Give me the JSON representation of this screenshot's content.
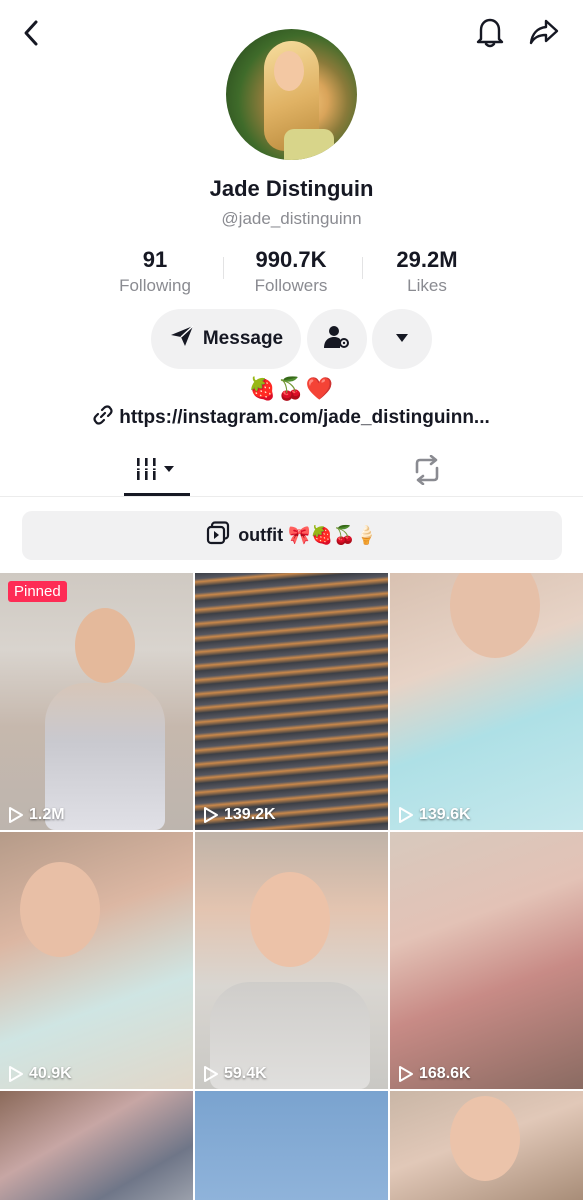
{
  "profile": {
    "name": "Jade Distinguin",
    "handle": "@jade_distinguinn",
    "stats": [
      {
        "value": "91",
        "label": "Following"
      },
      {
        "value": "990.7K",
        "label": "Followers"
      },
      {
        "value": "29.2M",
        "label": "Likes"
      }
    ],
    "message_label": "Message",
    "bio_emojis": "🍓🍒❤️",
    "link": "https://instagram.com/jade_distinguinn..."
  },
  "playlist": {
    "title": "outfit 🎀🍓🍒🍦"
  },
  "videos": [
    {
      "views": "1.2M",
      "pinned": "Pinned"
    },
    {
      "views": "139.2K"
    },
    {
      "views": "139.6K"
    },
    {
      "views": "40.9K"
    },
    {
      "views": "59.4K"
    },
    {
      "views": "168.6K"
    },
    {
      "views": ""
    },
    {
      "views": ""
    },
    {
      "views": ""
    }
  ],
  "icons": {
    "back": "back-arrow-icon",
    "bell": "bell-icon",
    "share": "share-icon",
    "send": "send-icon",
    "add_friend": "user-settings-icon",
    "more": "chevron-down-icon",
    "link": "link-icon",
    "grid": "grid-icon",
    "repost": "repost-icon",
    "playlist": "playlist-icon",
    "play": "play-icon"
  },
  "colors": {
    "pinned": "#fe2c55",
    "button_bg": "#f1f1f2"
  }
}
